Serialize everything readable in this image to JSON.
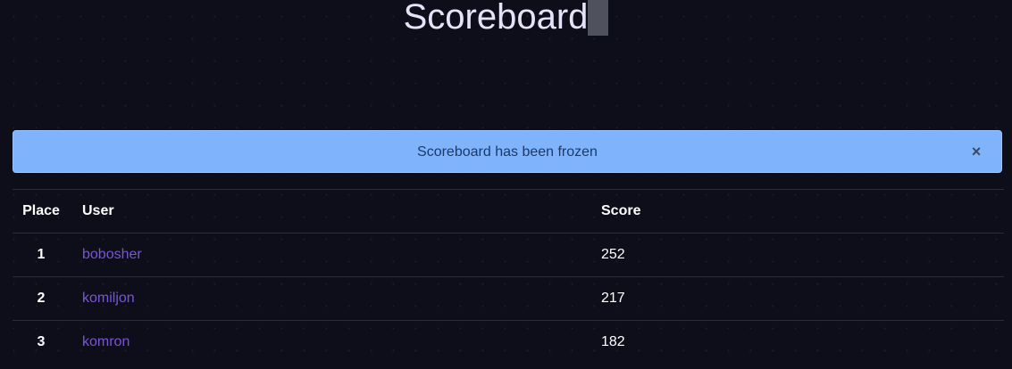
{
  "page": {
    "title": "Scoreboard"
  },
  "alert": {
    "message": "Scoreboard has been frozen",
    "close_icon": "×"
  },
  "table": {
    "headers": [
      "Place",
      "User",
      "Score"
    ],
    "rows": [
      {
        "place": "1",
        "user": "bobosher",
        "score": "252"
      },
      {
        "place": "2",
        "user": "komiljon",
        "score": "217"
      },
      {
        "place": "3",
        "user": "komron",
        "score": "182"
      }
    ]
  },
  "colors": {
    "background": "#0d0e1a",
    "alert_background": "#7fb4fd",
    "user_link": "#7a55d6"
  }
}
